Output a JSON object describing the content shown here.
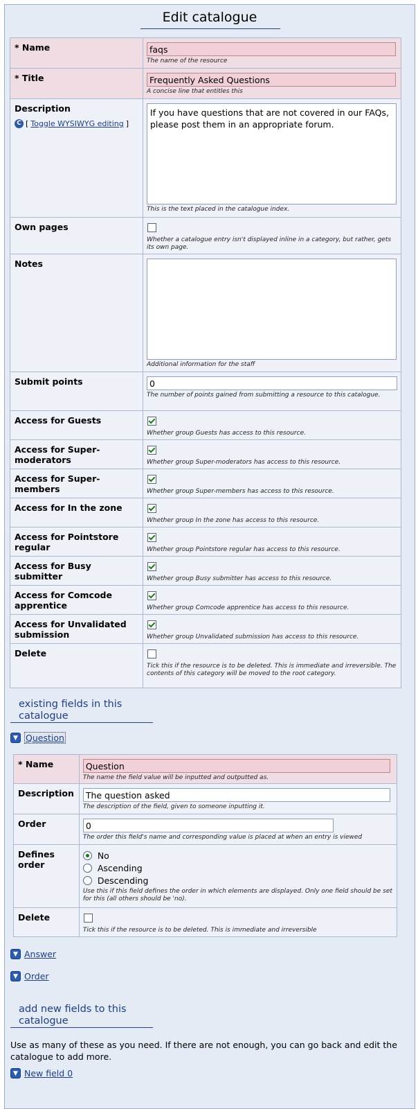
{
  "page_title": "Edit catalogue",
  "main_form": {
    "name": {
      "label": "* Name",
      "value": "faqs",
      "desc": "The name of the resource"
    },
    "title": {
      "label": "* Title",
      "value": "Frequently Asked Questions",
      "desc": "A concise line that entitles this"
    },
    "description": {
      "label": "Description",
      "toggle_text": "Toggle WYSIWYG editing",
      "toggle_open": "[",
      "toggle_close": "]",
      "value": "If you have questions that are not covered in our FAQs, please post them in an appropriate forum.",
      "desc": "This is the text placed in the catalogue index."
    },
    "own_pages": {
      "label": "Own pages",
      "checked": false,
      "desc": "Whether a catalogue entry isn't displayed inline in a category, but rather, gets its own page."
    },
    "notes": {
      "label": "Notes",
      "value": "",
      "desc": "Additional information for the staff"
    },
    "submit_points": {
      "label": "Submit points",
      "value": "0",
      "desc": "The number of points gained from submitting a resource to this catalogue."
    },
    "access": [
      {
        "label": "Access for Guests",
        "checked": true,
        "desc": "Whether group Guests has access to this resource."
      },
      {
        "label": "Access for Super-moderators",
        "checked": true,
        "desc": "Whether group Super-moderators has access to this resource."
      },
      {
        "label": "Access for Super-members",
        "checked": true,
        "desc": "Whether group Super-members has access to this resource."
      },
      {
        "label": "Access for In the zone",
        "checked": true,
        "desc": "Whether group In the zone has access to this resource."
      },
      {
        "label": "Access for Pointstore regular",
        "checked": true,
        "desc": "Whether group Pointstore regular has access to this resource."
      },
      {
        "label": "Access for Busy submitter",
        "checked": true,
        "desc": "Whether group Busy submitter has access to this resource."
      },
      {
        "label": "Access for Comcode apprentice",
        "checked": true,
        "desc": "Whether group Comcode apprentice has access to this resource."
      },
      {
        "label": "Access for Unvalidated submission",
        "checked": true,
        "desc": "Whether group Unvalidated submission has access to this resource."
      }
    ],
    "delete": {
      "label": "Delete",
      "checked": false,
      "desc": "Tick this if the resource is to be deleted. This is immediate and irreversible. The contents of this category will be moved to the root category."
    }
  },
  "existing_fields": {
    "heading": "existing fields in this catalogue",
    "question_link": "Question",
    "field_form": {
      "name": {
        "label": "* Name",
        "value": "Question",
        "desc": "The name the field value will be inputted and outputted as."
      },
      "description": {
        "label": "Description",
        "value": "The question asked",
        "desc": "The description of the field, given to someone inputting it."
      },
      "order": {
        "label": "Order",
        "value": "0",
        "desc": "The order this field's name and corresponding value is placed at when an entry is viewed"
      },
      "defines_order": {
        "label": "Defines order",
        "options": [
          "No",
          "Ascending",
          "Descending"
        ],
        "selected": "No",
        "desc": "Use this if this field defines the order in which elements are displayed. Only one field should be set for this (all others should be 'no)."
      },
      "delete": {
        "label": "Delete",
        "checked": false,
        "desc": "Tick this if the resource is to be deleted. This is immediate and irreversible"
      }
    },
    "other_links": [
      "Answer",
      "Order"
    ]
  },
  "new_fields": {
    "heading": "add new fields to this catalogue",
    "note": "Use as many of these as you need. If there are not enough, you can go back and edit the catalogue to add more.",
    "link": "New field 0"
  },
  "colors": {
    "accent": "#1c3f87",
    "required_bg": "#f0dde3",
    "panel_bg": "#e4ebf4",
    "row_bg": "#eef2f8"
  }
}
